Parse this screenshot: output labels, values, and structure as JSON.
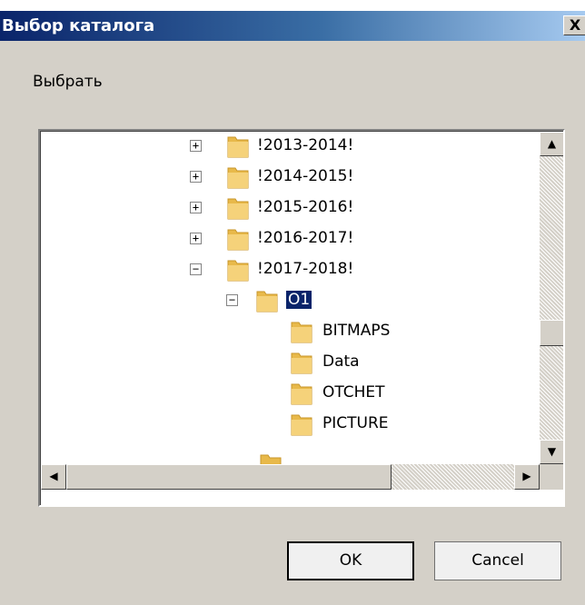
{
  "window": {
    "title": "Выбор каталога",
    "close_glyph": "X"
  },
  "label": "Выбрать",
  "tree": {
    "nodes": [
      {
        "label": "!2013-2014!",
        "expander": "+"
      },
      {
        "label": "!2014-2015!",
        "expander": "+"
      },
      {
        "label": "!2015-2016!",
        "expander": "+"
      },
      {
        "label": "!2016-2017!",
        "expander": "+"
      },
      {
        "label": "!2017-2018!",
        "expander": "−"
      },
      {
        "label": "O1",
        "expander": "−",
        "selected": true
      },
      {
        "label": "BITMAPS"
      },
      {
        "label": "Data"
      },
      {
        "label": "OTCHET"
      },
      {
        "label": "PICTURE"
      }
    ]
  },
  "scroll": {
    "up": "▲",
    "down": "▼",
    "left": "◀",
    "right": "▶"
  },
  "buttons": {
    "ok": "OK",
    "cancel": "Cancel"
  },
  "colors": {
    "title_bar": "#0a246a",
    "selection": "#0a246a",
    "dialog_bg": "#d4d0c8",
    "folder": "#e8b94a"
  }
}
